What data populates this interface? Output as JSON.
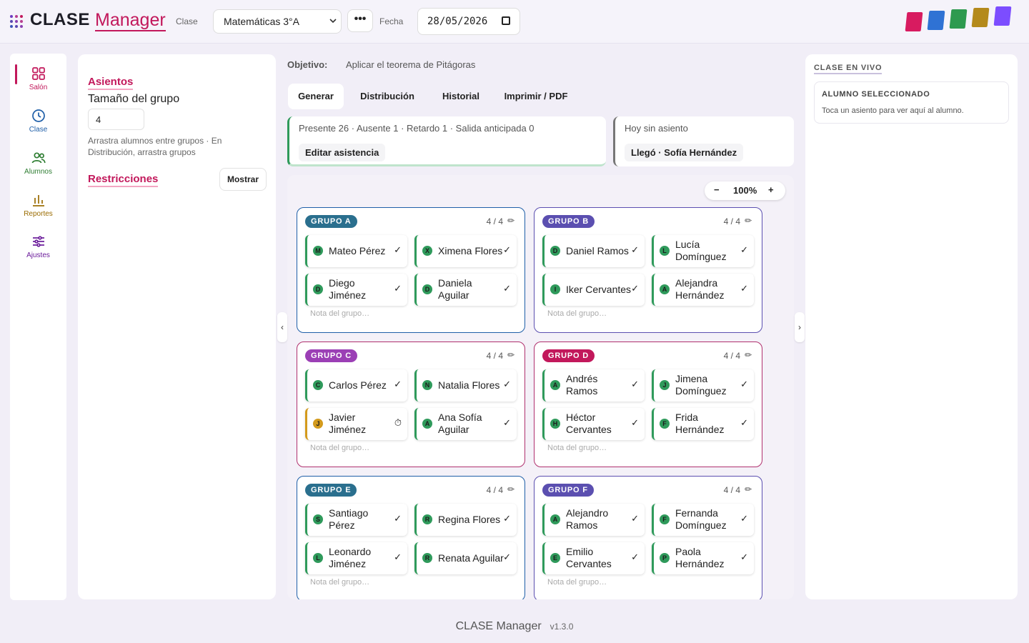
{
  "app": {
    "brand": "CLASE",
    "brand_sub": "Manager"
  },
  "topbar": {
    "class_label": "Clase",
    "class_value": "Matemáticas 3°A",
    "more_label": "•••",
    "date_label": "Fecha",
    "date_value": "28/05/2026"
  },
  "palette": [
    "#d81b60",
    "#2f72d4",
    "#2e9a4f",
    "#b48a1c",
    "#7c4dff"
  ],
  "nav": [
    {
      "label": "Salón",
      "icon": "grid-icon",
      "color": "#c2185b"
    },
    {
      "label": "Clase",
      "icon": "clock-icon",
      "color": "#1f5fa8"
    },
    {
      "label": "Alumnos",
      "icon": "users-icon",
      "color": "#2e7d32"
    },
    {
      "label": "Reportes",
      "icon": "bar-chart-icon",
      "color": "#9a6b00"
    },
    {
      "label": "Ajustes",
      "icon": "sliders-icon",
      "color": "#6a1b9a"
    }
  ],
  "seats_panel": {
    "title": "Asientos",
    "group_size_label": "Tamaño del grupo",
    "group_size_value": "4",
    "hint": "Arrastra alumnos entre grupos · En Distribución, arrastra grupos",
    "restrictions_label": "Restricciones",
    "show_button": "Mostrar"
  },
  "objective": {
    "label": "Objetivo:",
    "text": "Aplicar el teorema de Pitágoras"
  },
  "tabs": [
    "Generar",
    "Distribución",
    "Historial",
    "Imprimir / PDF"
  ],
  "attendance": {
    "summary": "Presente 26 · Ausente 1 · Retardo 1 · Salida anticipada 0",
    "edit_button": "Editar asistencia"
  },
  "no_seat": {
    "title": "Hoy sin asiento",
    "chip": "Llegó · Sofía Hernández"
  },
  "zoom": {
    "minus": "−",
    "value": "100%",
    "plus": "+"
  },
  "groups": [
    {
      "name": "GRUPO A",
      "count": "4 / 4",
      "color": "#1f5fa8",
      "badge": "#2a6f8e",
      "note": "Nota del grupo…",
      "students": [
        {
          "initial": "M",
          "name": "Mateo Pérez",
          "status": "✓",
          "color": "#2f9a5b"
        },
        {
          "initial": "X",
          "name": "Ximena Flores",
          "status": "✓",
          "color": "#2f9a5b"
        },
        {
          "initial": "D",
          "name": "Diego Jiménez",
          "status": "✓",
          "color": "#2f9a5b"
        },
        {
          "initial": "D",
          "name": "Daniela Aguilar",
          "status": "✓",
          "color": "#2f9a5b"
        }
      ]
    },
    {
      "name": "GRUPO B",
      "count": "4 / 4",
      "color": "#5b4fb0",
      "badge": "#5b4fb0",
      "note": "Nota del grupo…",
      "students": [
        {
          "initial": "D",
          "name": "Daniel Ramos",
          "status": "✓",
          "color": "#2f9a5b"
        },
        {
          "initial": "L",
          "name": "Lucía Domínguez",
          "status": "✓",
          "color": "#2f9a5b"
        },
        {
          "initial": "I",
          "name": "Iker Cervantes",
          "status": "✓",
          "color": "#2f9a5b"
        },
        {
          "initial": "A",
          "name": "Alejandra Hernández",
          "status": "✓",
          "color": "#2f9a5b"
        }
      ]
    },
    {
      "name": "GRUPO C",
      "count": "4 / 4",
      "color": "#b0306e",
      "badge": "#9b3fb5",
      "note": "Nota del grupo…",
      "students": [
        {
          "initial": "C",
          "name": "Carlos Pérez",
          "status": "✓",
          "color": "#2f9a5b"
        },
        {
          "initial": "N",
          "name": "Natalia Flores",
          "status": "✓",
          "color": "#2f9a5b"
        },
        {
          "initial": "J",
          "name": "Javier Jiménez",
          "status": "⏱",
          "color": "#d39a1c"
        },
        {
          "initial": "A",
          "name": "Ana Sofía Aguilar",
          "status": "✓",
          "color": "#2f9a5b"
        }
      ]
    },
    {
      "name": "GRUPO D",
      "count": "4 / 4",
      "color": "#b0306e",
      "badge": "#c2185b",
      "note": "Nota del grupo…",
      "students": [
        {
          "initial": "A",
          "name": "Andrés Ramos",
          "status": "✓",
          "color": "#2f9a5b"
        },
        {
          "initial": "J",
          "name": "Jimena Domínguez",
          "status": "✓",
          "color": "#2f9a5b"
        },
        {
          "initial": "H",
          "name": "Héctor Cervantes",
          "status": "✓",
          "color": "#2f9a5b"
        },
        {
          "initial": "F",
          "name": "Frida Hernández",
          "status": "✓",
          "color": "#2f9a5b"
        }
      ]
    },
    {
      "name": "GRUPO E",
      "count": "4 / 4",
      "color": "#1f5fa8",
      "badge": "#2a6f8e",
      "note": "Nota del grupo…",
      "students": [
        {
          "initial": "S",
          "name": "Santiago Pérez",
          "status": "✓",
          "color": "#2f9a5b"
        },
        {
          "initial": "R",
          "name": "Regina Flores",
          "status": "✓",
          "color": "#2f9a5b"
        },
        {
          "initial": "L",
          "name": "Leonardo Jiménez",
          "status": "✓",
          "color": "#2f9a5b"
        },
        {
          "initial": "R",
          "name": "Renata Aguilar",
          "status": "✓",
          "color": "#2f9a5b"
        }
      ]
    },
    {
      "name": "GRUPO F",
      "count": "4 / 4",
      "color": "#5b4fb0",
      "badge": "#5b4fb0",
      "note": "Nota del grupo…",
      "students": [
        {
          "initial": "A",
          "name": "Alejandro Ramos",
          "status": "✓",
          "color": "#2f9a5b"
        },
        {
          "initial": "F",
          "name": "Fernanda Domínguez",
          "status": "✓",
          "color": "#2f9a5b"
        },
        {
          "initial": "E",
          "name": "Emilio Cervantes",
          "status": "✓",
          "color": "#2f9a5b"
        },
        {
          "initial": "P",
          "name": "Paola Hernández",
          "status": "✓",
          "color": "#2f9a5b"
        }
      ]
    }
  ],
  "edges": {
    "left": "‹",
    "right": "›"
  },
  "live_panel": {
    "title": "CLASE EN VIVO",
    "card_title": "ALUMNO SELECCIONADO",
    "card_text": "Toca un asiento para ver aquí al alumno."
  },
  "footer": {
    "name": "CLASE Manager",
    "version": "v1.3.0"
  }
}
